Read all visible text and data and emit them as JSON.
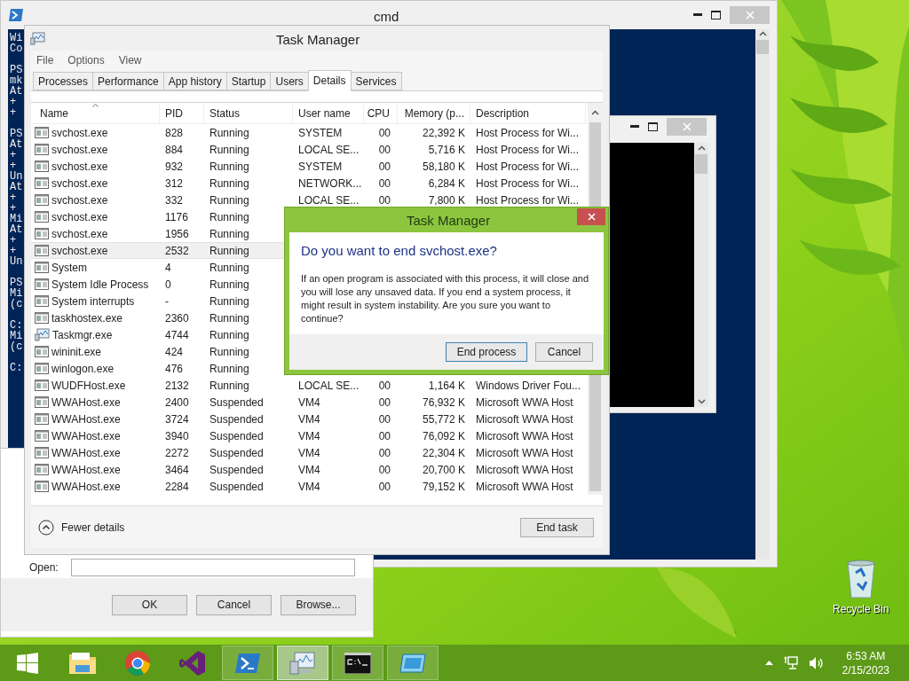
{
  "desktop": {
    "icons": [
      {
        "label": "Recycle Bin"
      }
    ]
  },
  "cmd_window": {
    "title": "cmd",
    "console_blocks": [
      [
        "Wi",
        "Co"
      ],
      [
        "PS",
        "mk",
        "At",
        "+",
        "+"
      ],
      [
        "PS",
        "At",
        "+",
        "+",
        "Un",
        "At",
        "+",
        "+",
        "Mi",
        "At",
        "+",
        "+",
        "Un"
      ],
      [
        "PS",
        "Mi",
        "(c"
      ],
      [
        "C:",
        "Mi",
        "(c"
      ],
      [
        "C:"
      ]
    ]
  },
  "run_dialog": {
    "open_label": "Open:",
    "buttons": [
      "OK",
      "Cancel",
      "Browse..."
    ]
  },
  "task_manager": {
    "title": "Task Manager",
    "menu": [
      "File",
      "Options",
      "View"
    ],
    "tabs": [
      {
        "label": "Processes",
        "selected": false
      },
      {
        "label": "Performance",
        "selected": false
      },
      {
        "label": "App history",
        "selected": false
      },
      {
        "label": "Startup",
        "selected": false
      },
      {
        "label": "Users",
        "selected": false
      },
      {
        "label": "Details",
        "selected": true
      },
      {
        "label": "Services",
        "selected": false
      }
    ],
    "columns": [
      "Name",
      "PID",
      "Status",
      "User name",
      "CPU",
      "Memory (p...",
      "Description"
    ],
    "rows": [
      {
        "kind": "service",
        "name": "svchost.exe",
        "pid": "828",
        "status": "Running",
        "user": "SYSTEM",
        "cpu": "00",
        "memory": "22,392 K",
        "description": "Host Process for Wi...",
        "selected": false
      },
      {
        "kind": "service",
        "name": "svchost.exe",
        "pid": "884",
        "status": "Running",
        "user": "LOCAL SE...",
        "cpu": "00",
        "memory": "5,716 K",
        "description": "Host Process for Wi...",
        "selected": false
      },
      {
        "kind": "service",
        "name": "svchost.exe",
        "pid": "932",
        "status": "Running",
        "user": "SYSTEM",
        "cpu": "00",
        "memory": "58,180 K",
        "description": "Host Process for Wi...",
        "selected": false
      },
      {
        "kind": "service",
        "name": "svchost.exe",
        "pid": "312",
        "status": "Running",
        "user": "NETWORK...",
        "cpu": "00",
        "memory": "6,284 K",
        "description": "Host Process for Wi...",
        "selected": false
      },
      {
        "kind": "service",
        "name": "svchost.exe",
        "pid": "332",
        "status": "Running",
        "user": "LOCAL SE...",
        "cpu": "00",
        "memory": "7,800 K",
        "description": "Host Process for Wi...",
        "selected": false
      },
      {
        "kind": "service",
        "name": "svchost.exe",
        "pid": "1176",
        "status": "Running",
        "selected": false
      },
      {
        "kind": "service",
        "name": "svchost.exe",
        "pid": "1956",
        "status": "Running",
        "selected": false
      },
      {
        "kind": "service",
        "name": "svchost.exe",
        "pid": "2532",
        "status": "Running",
        "selected": true
      },
      {
        "kind": "service",
        "name": "System",
        "pid": "4",
        "status": "Running",
        "selected": false
      },
      {
        "kind": "service",
        "name": "System Idle Process",
        "pid": "0",
        "status": "Running",
        "selected": false
      },
      {
        "kind": "service",
        "name": "System interrupts",
        "pid": "-",
        "status": "Running",
        "selected": false
      },
      {
        "kind": "service",
        "name": "taskhostex.exe",
        "pid": "2360",
        "status": "Running",
        "selected": false
      },
      {
        "kind": "monitor",
        "name": "Taskmgr.exe",
        "pid": "4744",
        "status": "Running",
        "selected": false
      },
      {
        "kind": "service",
        "name": "wininit.exe",
        "pid": "424",
        "status": "Running",
        "selected": false
      },
      {
        "kind": "service",
        "name": "winlogon.exe",
        "pid": "476",
        "status": "Running",
        "selected": false
      },
      {
        "kind": "service",
        "name": "WUDFHost.exe",
        "pid": "2132",
        "status": "Running",
        "user": "LOCAL SE...",
        "cpu": "00",
        "memory": "1,164 K",
        "description": "Windows Driver Fou...",
        "selected": false
      },
      {
        "kind": "service",
        "name": "WWAHost.exe",
        "pid": "2400",
        "status": "Suspended",
        "user": "VM4",
        "cpu": "00",
        "memory": "76,932 K",
        "description": "Microsoft WWA Host",
        "selected": false
      },
      {
        "kind": "service",
        "name": "WWAHost.exe",
        "pid": "3724",
        "status": "Suspended",
        "user": "VM4",
        "cpu": "00",
        "memory": "55,772 K",
        "description": "Microsoft WWA Host",
        "selected": false
      },
      {
        "kind": "service",
        "name": "WWAHost.exe",
        "pid": "3940",
        "status": "Suspended",
        "user": "VM4",
        "cpu": "00",
        "memory": "76,092 K",
        "description": "Microsoft WWA Host",
        "selected": false
      },
      {
        "kind": "service",
        "name": "WWAHost.exe",
        "pid": "2272",
        "status": "Suspended",
        "user": "VM4",
        "cpu": "00",
        "memory": "22,304 K",
        "description": "Microsoft WWA Host",
        "selected": false
      },
      {
        "kind": "service",
        "name": "WWAHost.exe",
        "pid": "3464",
        "status": "Suspended",
        "user": "VM4",
        "cpu": "00",
        "memory": "20,700 K",
        "description": "Microsoft WWA Host",
        "selected": false
      },
      {
        "kind": "service",
        "name": "WWAHost.exe",
        "pid": "2284",
        "status": "Suspended",
        "user": "VM4",
        "cpu": "00",
        "memory": "79,152 K",
        "description": "Microsoft WWA Host",
        "selected": false
      }
    ],
    "fewer_details": "Fewer details",
    "end_task": "End task"
  },
  "confirm_dialog": {
    "title": "Task Manager",
    "heading": "Do you want to end svchost.exe?",
    "message": "If an open program is associated with this process, it will close and you will lose any unsaved data. If you end a system process, it might result in system instability. Are you sure you want to continue?",
    "buttons": [
      {
        "label": "End process",
        "selected": true
      },
      {
        "label": "Cancel",
        "selected": false
      }
    ]
  },
  "taskbar": {
    "apps": [
      {
        "kind": "start",
        "running": false,
        "selected": false
      },
      {
        "kind": "explorer",
        "running": false,
        "selected": false
      },
      {
        "kind": "chrome",
        "running": false,
        "selected": false
      },
      {
        "kind": "studio",
        "running": false,
        "selected": false
      },
      {
        "kind": "powershell",
        "running": true,
        "selected": false
      },
      {
        "kind": "taskmgr",
        "running": true,
        "selected": true
      },
      {
        "kind": "console",
        "running": true,
        "selected": false
      },
      {
        "kind": "remote",
        "running": true,
        "selected": false
      }
    ],
    "clock": {
      "time": "6:53 AM",
      "date": "2/15/2023"
    }
  }
}
